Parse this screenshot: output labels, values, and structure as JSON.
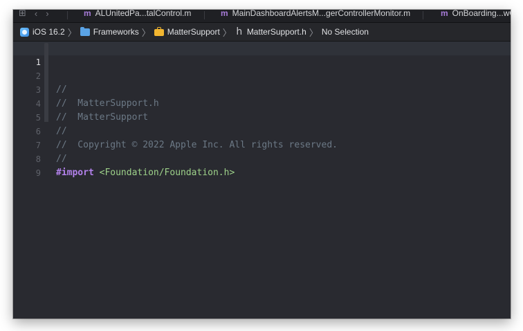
{
  "tabs": [
    {
      "label": "ALUnitedPa...talControl.m"
    },
    {
      "label": "MainDashboardAlertsM...gerControllerMonitor.m"
    },
    {
      "label": "OnBoarding...wC"
    }
  ],
  "tab_file_icon": "m",
  "breadcrumb": {
    "sdk": "iOS 16.2",
    "folder": "Frameworks",
    "group": "MatterSupport",
    "file": "MatterSupport.h",
    "file_icon_glyph": "h",
    "selection": "No Selection",
    "separator": "〉"
  },
  "editor": {
    "lines": [
      {
        "number": "1",
        "comment": "//"
      },
      {
        "number": "2",
        "comment": "//  MatterSupport.h"
      },
      {
        "number": "3",
        "comment": "//  MatterSupport"
      },
      {
        "number": "4",
        "comment": "//"
      },
      {
        "number": "5",
        "comment": "//  Copyright © 2022 Apple Inc. All rights reserved."
      },
      {
        "number": "6",
        "comment": "//"
      },
      {
        "number": "7",
        "comment": ""
      },
      {
        "number": "8",
        "keyword": "#import",
        "string": "<Foundation/Foundation.h>"
      },
      {
        "number": "9",
        "comment": ""
      }
    ]
  },
  "colors": {
    "background": "#292a30",
    "comment": "#6c7986",
    "keyword": "#b281eb",
    "string": "#9ed28a",
    "current_line": "#2f3239"
  }
}
